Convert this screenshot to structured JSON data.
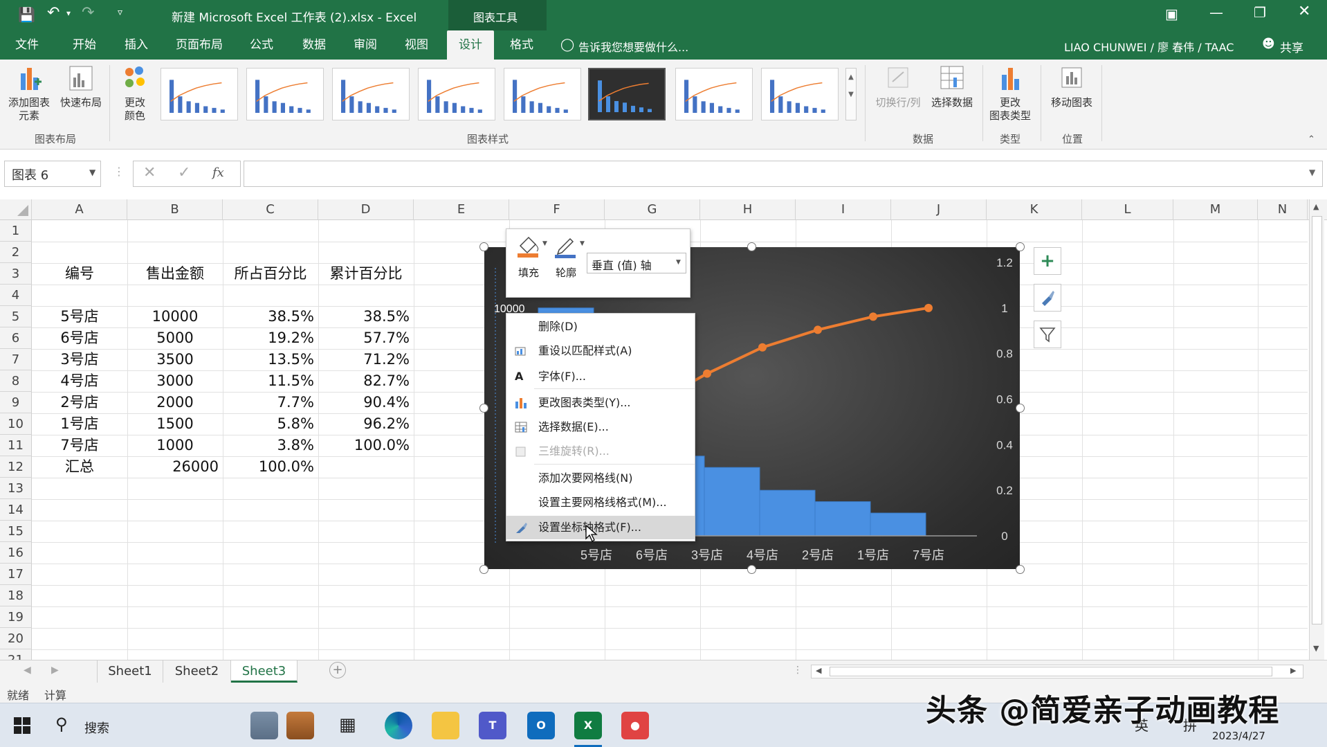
{
  "window": {
    "title": "新建 Microsoft Excel 工作表 (2).xlsx - Excel",
    "context_tool": "图表工具",
    "user": "LIAO CHUNWEI / 廖 春伟 / TAAC",
    "share": "共享"
  },
  "ribbon_tabs": [
    "文件",
    "开始",
    "插入",
    "页面布局",
    "公式",
    "数据",
    "审阅",
    "视图",
    "设计",
    "格式"
  ],
  "active_tab": "设计",
  "tell_me": "告诉我您想要做什么...",
  "ribbon": {
    "add_element": "添加图表\n元素",
    "quick_layout": "快速布局",
    "change_color": "更改\n颜色",
    "group_layout": "图表布局",
    "group_styles": "图表样式",
    "switch_row_col": "切换行/列",
    "select_data": "选择数据",
    "group_data": "数据",
    "change_type": "更改\n图表类型",
    "group_type": "类型",
    "move_chart": "移动图表",
    "group_position": "位置"
  },
  "formula_bar": {
    "name_box": "图表 6",
    "fx": "fx",
    "content": ""
  },
  "columns": [
    "A",
    "B",
    "C",
    "D",
    "E",
    "F",
    "G",
    "H",
    "I",
    "J",
    "K",
    "L",
    "M",
    "N"
  ],
  "rows": [
    "1",
    "2",
    "3",
    "4",
    "5",
    "6",
    "7",
    "8",
    "9",
    "10",
    "11",
    "12",
    "13",
    "14",
    "15",
    "16",
    "17",
    "18",
    "19",
    "20",
    "21"
  ],
  "table": {
    "headers": [
      "编号",
      "售出金额",
      "所占百分比",
      "累计百分比"
    ],
    "data": [
      [
        "5号店",
        "10000",
        "38.5%",
        "38.5%"
      ],
      [
        "6号店",
        "5000",
        "19.2%",
        "57.7%"
      ],
      [
        "3号店",
        "3500",
        "13.5%",
        "71.2%"
      ],
      [
        "4号店",
        "3000",
        "11.5%",
        "82.7%"
      ],
      [
        "2号店",
        "2000",
        "7.7%",
        "90.4%"
      ],
      [
        "1号店",
        "1500",
        "5.8%",
        "96.2%"
      ],
      [
        "7号店",
        "1000",
        "3.8%",
        "100.0%"
      ]
    ],
    "total": [
      "汇总",
      "26000",
      "100.0%"
    ]
  },
  "chart_data": {
    "type": "bar",
    "categories": [
      "5号店",
      "6号店",
      "3号店",
      "4号店",
      "2号店",
      "1号店",
      "7号店"
    ],
    "series": [
      {
        "values": [
          10000,
          5000,
          3500,
          3000,
          2000,
          1500,
          1000
        ]
      },
      {
        "values": [
          0.385,
          0.577,
          0.712,
          0.827,
          0.904,
          0.962,
          1.0
        ]
      }
    ],
    "y_primary_visible_ticks": [
      "10000"
    ],
    "y_secondary_ticks": [
      "0",
      "0.2",
      "0.4",
      "0.6",
      "0.8",
      "1",
      "1.2"
    ],
    "ylim": [
      0,
      12000
    ],
    "y2lim": [
      0,
      1.2
    ],
    "bar_color": "#4a90e2",
    "line_color": "#ed7d31",
    "background": "#333333"
  },
  "mini_toolbar": {
    "fill": "填充",
    "outline": "轮廓",
    "selector": "垂直 (值) 轴"
  },
  "context_menu": [
    {
      "label": "删除(D)",
      "enabled": true
    },
    {
      "label": "重设以匹配样式(A)",
      "enabled": true
    },
    {
      "label": "字体(F)...",
      "enabled": true
    },
    {
      "label": "更改图表类型(Y)...",
      "enabled": true
    },
    {
      "label": "选择数据(E)...",
      "enabled": true
    },
    {
      "label": "三维旋转(R)...",
      "enabled": false
    },
    {
      "label": "添加次要网格线(N)",
      "enabled": true
    },
    {
      "label": "设置主要网格线格式(M)...",
      "enabled": true
    },
    {
      "label": "设置坐标轴格式(F)...",
      "enabled": true,
      "highlighted": true
    }
  ],
  "sheets": [
    "Sheet1",
    "Sheet2",
    "Sheet3"
  ],
  "active_sheet": "Sheet3",
  "status": {
    "ready": "就绪",
    "calc": "计算"
  },
  "taskbar": {
    "search": "搜索",
    "date": "2023/4/27",
    "ime1": "英",
    "ime2": "拼"
  },
  "watermark": "头条 @简爱亲子动画教程",
  "colors": {
    "excel_green": "#217346",
    "accent_orange": "#ed7d31",
    "bar_blue": "#4a90e2"
  }
}
